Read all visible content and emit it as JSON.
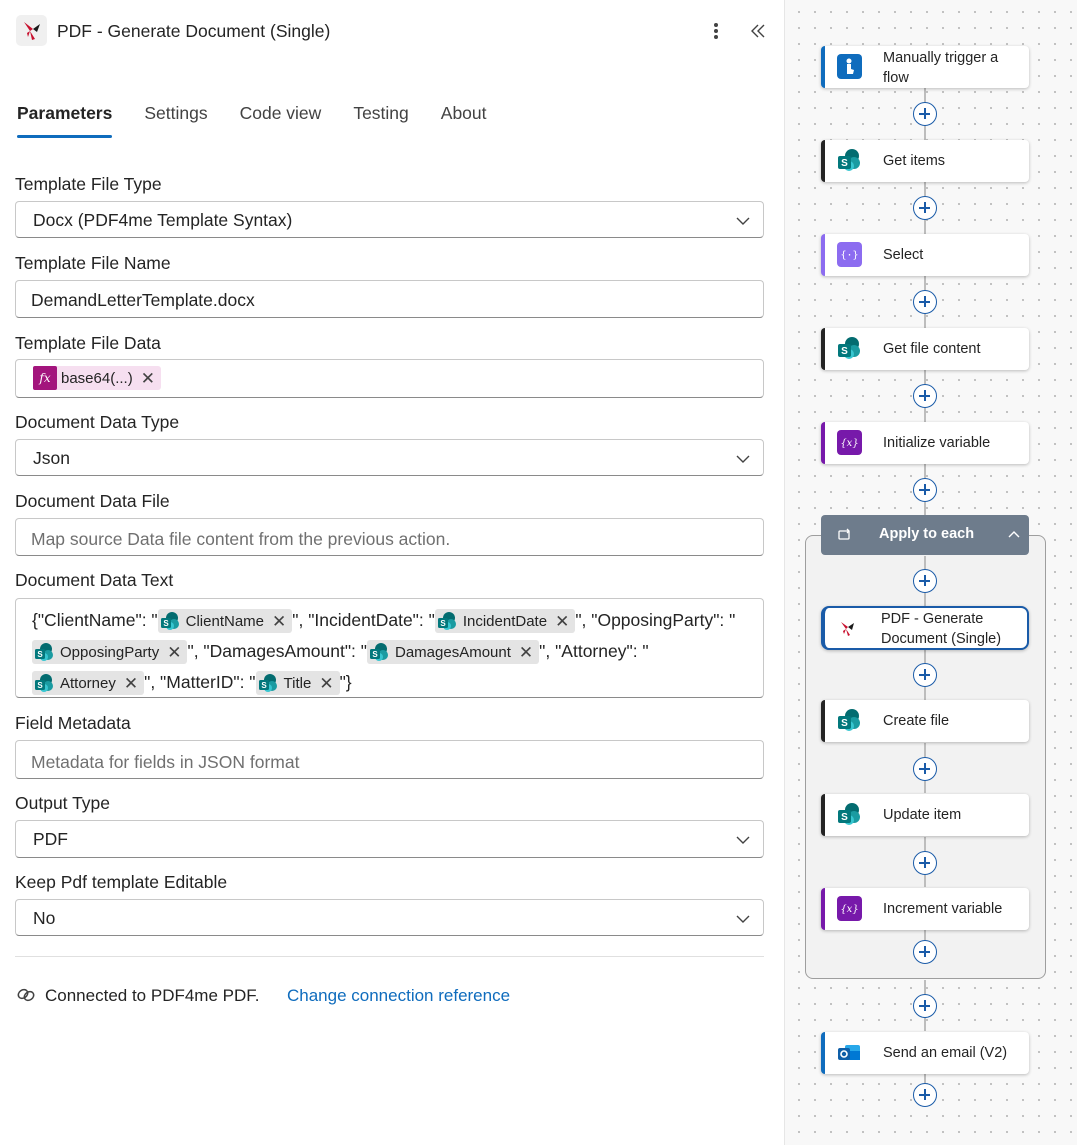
{
  "panel": {
    "title": "PDF - Generate Document (Single)",
    "tabs": [
      {
        "label": "Parameters",
        "active": true
      },
      {
        "label": "Settings"
      },
      {
        "label": "Code view"
      },
      {
        "label": "Testing"
      },
      {
        "label": "About"
      }
    ],
    "fields": {
      "template_file_type": {
        "label": "Template File Type",
        "value": "Docx (PDF4me Template Syntax)"
      },
      "template_file_name": {
        "label": "Template File Name",
        "value": "DemandLetterTemplate.docx"
      },
      "template_file_data": {
        "label": "Template File Data",
        "token": "base64(...)"
      },
      "document_data_type": {
        "label": "Document Data Type",
        "value": "Json"
      },
      "document_data_file": {
        "label": "Document Data File",
        "placeholder": "Map source Data file content from the previous action."
      },
      "document_data_text": {
        "label": "Document Data Text",
        "parts": {
          "p1": "{\"ClientName\": \"",
          "t1": "ClientName",
          "p2": "\", \"IncidentDate\": \"",
          "t2": "IncidentDate",
          "p3": "\", \"OpposingParty\": \"",
          "t3": "OpposingParty",
          "p4": "\", \"DamagesAmount\": \"",
          "t4": "DamagesAmount",
          "p5": "\", \"Attorney\": \"",
          "t5": "Attorney",
          "p6": "\", \"MatterID\": \"",
          "t6": "Title",
          "p7": "\"}"
        }
      },
      "field_metadata": {
        "label": "Field Metadata",
        "placeholder": "Metadata for fields in JSON format"
      },
      "output_type": {
        "label": "Output Type",
        "value": "PDF"
      },
      "keep_editable": {
        "label": "Keep Pdf template Editable",
        "value": "No"
      }
    },
    "connection": {
      "text": "Connected to PDF4me PDF.",
      "link": "Change connection reference"
    }
  },
  "flow": {
    "steps": {
      "trigger": {
        "line1": "Manually trigger a",
        "line2": "flow",
        "icon": "trigger-icon"
      },
      "get_items": {
        "label": "Get items",
        "icon": "sharepoint-icon"
      },
      "select": {
        "label": "Select",
        "icon": "data-operation-icon"
      },
      "get_file_content": {
        "label": "Get file content",
        "icon": "sharepoint-icon"
      },
      "init_var": {
        "label": "Initialize variable",
        "icon": "variable-icon"
      },
      "apply_each": {
        "label": "Apply to each",
        "icon": "loop-icon"
      },
      "pdf_generate": {
        "line1": "PDF - Generate",
        "line2": "Document (Single)",
        "icon": "pdf4me-icon"
      },
      "create_file": {
        "label": "Create file",
        "icon": "sharepoint-icon"
      },
      "update_item": {
        "label": "Update item",
        "icon": "sharepoint-icon"
      },
      "increment_var": {
        "label": "Increment variable",
        "icon": "variable-icon"
      },
      "send_email": {
        "label": "Send an email (V2)",
        "icon": "outlook-icon"
      }
    }
  },
  "colors": {
    "accent": "#0f6cbd",
    "variable": "#7719aa",
    "trigger": "#0f6cbd",
    "scope_header": "#6e7c8c"
  }
}
